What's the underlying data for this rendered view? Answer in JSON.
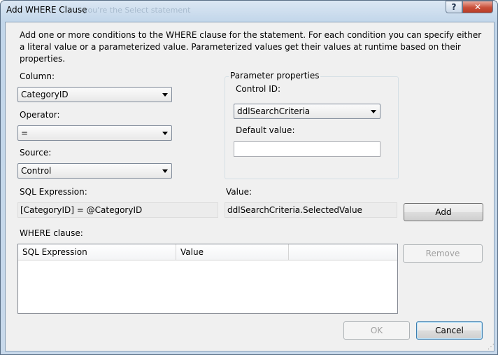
{
  "window": {
    "title": "Add WHERE Clause",
    "ghost_title": "you're the Select statement",
    "help_label": "?",
    "close_label": "✕"
  },
  "description": "Add one or more conditions to the WHERE clause for the statement. For each condition you can specify either a literal value or a parameterized value. Parameterized values get their values at runtime based on their properties.",
  "column": {
    "label": "Column:",
    "value": "CategoryID"
  },
  "operator": {
    "label": "Operator:",
    "value": "="
  },
  "source": {
    "label": "Source:",
    "value": "Control"
  },
  "parameter_properties": {
    "group_label": "Parameter properties",
    "control_id_label": "Control ID:",
    "control_id_value": "ddlSearchCriteria",
    "default_value_label": "Default value:",
    "default_value": ""
  },
  "sql_expression": {
    "label": "SQL Expression:",
    "value": "[CategoryID] = @CategoryID"
  },
  "value_field": {
    "label": "Value:",
    "value": "ddlSearchCriteria.SelectedValue"
  },
  "buttons": {
    "add": "Add",
    "remove": "Remove",
    "ok": "OK",
    "cancel": "Cancel"
  },
  "where_clause": {
    "label": "WHERE clause:",
    "columns": [
      "SQL Expression",
      "Value",
      ""
    ],
    "rows": []
  }
}
